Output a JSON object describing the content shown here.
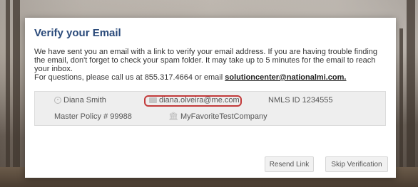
{
  "modal": {
    "title": "Verify your Email",
    "message_line1": "We have sent you an email with a link to verify your email address. If you are having trouble finding",
    "message_line2": "the email, don't forget to check your spam folder. It may take up to 5 minutes for the email to reach",
    "message_line3": "your inbox.",
    "contact_prefix": "For questions, please call us at 855.317.4664 or email",
    "contact_email": "solutioncenter@nationalmi.com."
  },
  "profile": {
    "name": "Diana Smith",
    "email": "diana.olveira@me.com",
    "nmls": "NMLS ID 1234555",
    "master_policy": "Master Policy # 99988",
    "company": "MyFavoriteTestCompany",
    "icons": {
      "name": "user-icon",
      "email": "envelope-icon",
      "company": "bank-icon"
    }
  },
  "actions": {
    "resend_label": "Resend Link",
    "skip_label": "Skip Verification"
  },
  "colors": {
    "title": "#2a4a7a",
    "highlight": "#c23a3a"
  }
}
